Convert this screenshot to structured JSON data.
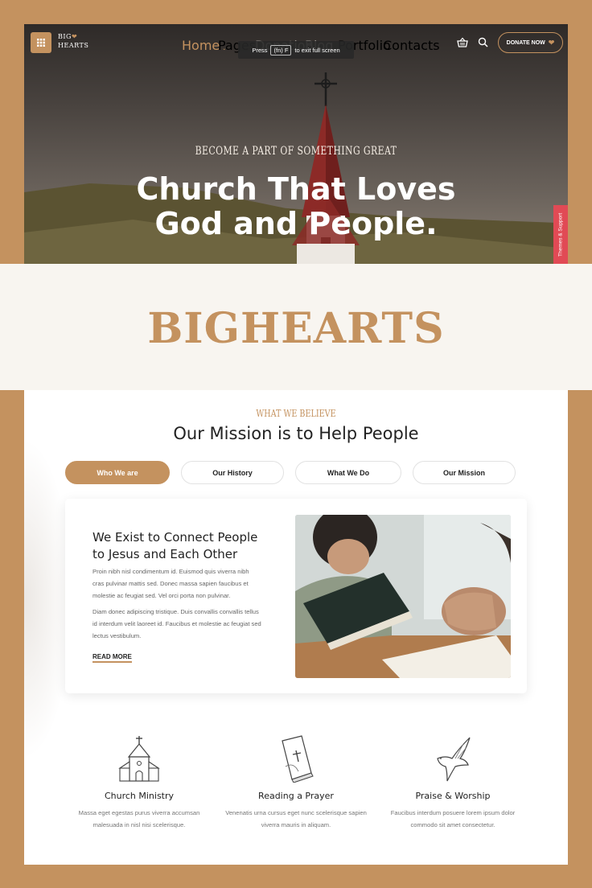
{
  "colors": {
    "accent": "#c4925f",
    "background": "#c4925f",
    "support": "#e14a55"
  },
  "header": {
    "logo_line1": "BIG",
    "logo_line2": "HEARTS",
    "nav": [
      {
        "label": "Home",
        "caret": true
      },
      {
        "label": "Pages",
        "caret": false
      },
      {
        "label": "Donation",
        "caret": false
      },
      {
        "label": "Blog",
        "caret": false
      },
      {
        "label": "Portfolio",
        "caret": true
      },
      {
        "label": "Contacts",
        "caret": false
      }
    ],
    "fullscreen_tip": {
      "press": "Press",
      "key": "(fn) F",
      "rest": "to exit full screen"
    },
    "donate_label": "DONATE NOW"
  },
  "hero": {
    "kicker": "BECOME A PART OF SOMETHING GREAT",
    "title_line1": "Church That Loves",
    "title_line2": "God and People.",
    "support_tab": "Themes & Support"
  },
  "banner": {
    "title": "BIGHEARTS"
  },
  "mission": {
    "kicker": "WHAT WE BELIEVE",
    "title": "Our Mission is to Help People",
    "tabs": [
      "Who We are",
      "Our History",
      "What We Do",
      "Our Mission"
    ],
    "panel": {
      "title": "We Exist to Connect People to Jesus and Each Other",
      "p1": "Proin nibh nisl condimentum id. Euismod quis viverra nibh cras pulvinar mattis sed. Donec massa sapien faucibus et molestie ac feugiat sed. Vel orci porta non pulvinar.",
      "p2": "Diam donec adipiscing tristique. Duis convallis convallis tellus id interdum velit laoreet id. Faucibus et molestie ac feugiat sed lectus vestibulum.",
      "read_more": "READ MORE"
    }
  },
  "features": [
    {
      "title": "Church Ministry",
      "desc": "Massa eget egestas purus viverra accumsan malesuada in nisl nisi scelerisque."
    },
    {
      "title": "Reading a Prayer",
      "desc": "Venenatis urna cursus eget nunc scelerisque sapien viverra mauris in aliquam."
    },
    {
      "title": "Praise & Worship",
      "desc": "Faucibus interdum posuere lorem ipsum dolor commodo sit amet consectetur."
    }
  ]
}
